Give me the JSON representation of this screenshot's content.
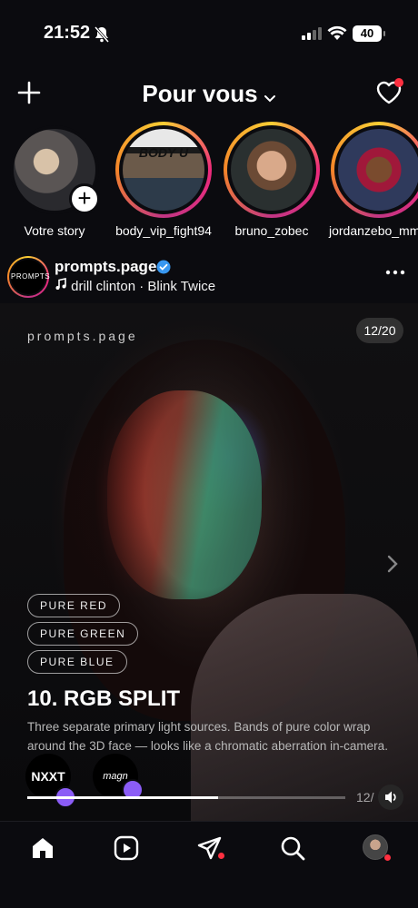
{
  "status_bar": {
    "time": "21:52",
    "battery": "40"
  },
  "topnav": {
    "title": "Pour vous"
  },
  "stories": [
    {
      "name": "Votre story"
    },
    {
      "name": "body_vip_fight94",
      "inner_text": "BODY U"
    },
    {
      "name": "bruno_zobec"
    },
    {
      "name": "jordanzebo_mm"
    }
  ],
  "post": {
    "avatar_text": "PROMPTS",
    "username": "prompts.page",
    "music": "drill clinton · Blink Twice",
    "brand": "prompts.page",
    "counter": "12/20",
    "tags": [
      "PURE RED",
      "PURE GREEN",
      "PURE BLUE"
    ],
    "heading": "10. RGB SPLIT",
    "description": "Three separate primary light sources. Bands of pure color wrap around the 3D face — looks like a chromatic aberration in-camera.",
    "progress_text": "12/",
    "progress": 0.6,
    "chips": [
      "NXXT",
      "magn"
    ]
  },
  "colors": {
    "accent_badge": "#8b5cf6",
    "notification": "#ff3040"
  },
  "icons": [
    "bell-muted-icon",
    "signal-icon",
    "wifi-icon",
    "plus-icon",
    "chevron-down-icon",
    "heart-icon",
    "verified-icon",
    "music-note-icon",
    "more-icon",
    "chevron-right-icon",
    "sound-icon",
    "home-icon",
    "reels-icon",
    "send-icon",
    "search-icon"
  ]
}
